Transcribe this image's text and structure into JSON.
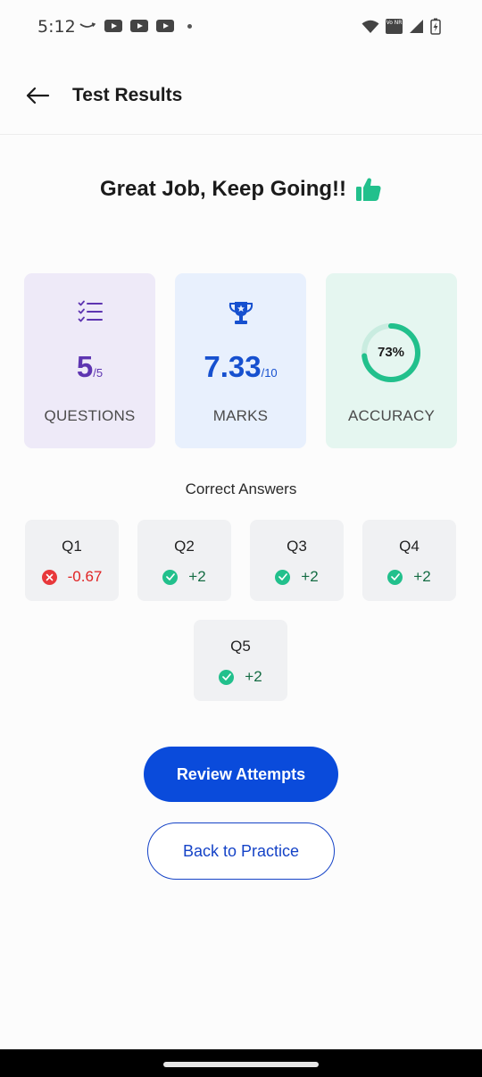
{
  "status_bar": {
    "time": "5:12",
    "volte_label": "Vo NR",
    "icons": [
      "amazon-smile-icon",
      "youtube-icon",
      "youtube-icon",
      "youtube-icon",
      "dot-icon",
      "wifi-icon",
      "volte-icon",
      "signal-icon",
      "battery-charging-icon"
    ]
  },
  "app_bar": {
    "title": "Test Results",
    "back_icon": "arrow-left-icon"
  },
  "headline": {
    "text": "Great Job, Keep Going!!",
    "icon": "thumbs-up-icon"
  },
  "stats": {
    "questions": {
      "value": "5",
      "total": "/5",
      "label": "QUESTIONS",
      "icon": "checklist-icon"
    },
    "marks": {
      "value": "7.33",
      "total": "/10",
      "label": "MARKS",
      "icon": "trophy-icon"
    },
    "accuracy": {
      "value": "73%",
      "fraction": 0.73,
      "label": "ACCURACY"
    }
  },
  "correct_answers": {
    "title": "Correct Answers",
    "items": [
      {
        "question": "Q1",
        "score": "-0.67",
        "status": "wrong"
      },
      {
        "question": "Q2",
        "score": "+2",
        "status": "correct"
      },
      {
        "question": "Q3",
        "score": "+2",
        "status": "correct"
      },
      {
        "question": "Q4",
        "score": "+2",
        "status": "correct"
      },
      {
        "question": "Q5",
        "score": "+2",
        "status": "correct"
      }
    ]
  },
  "actions": {
    "review_label": "Review Attempts",
    "back_label": "Back to Practice"
  },
  "colors": {
    "primary": "#0a4bdb",
    "success": "#22c08c",
    "error": "#e8383b",
    "questions_bg": "#eeeaf8",
    "marks_bg": "#e8f0fd",
    "accuracy_bg": "#e5f6f0"
  }
}
